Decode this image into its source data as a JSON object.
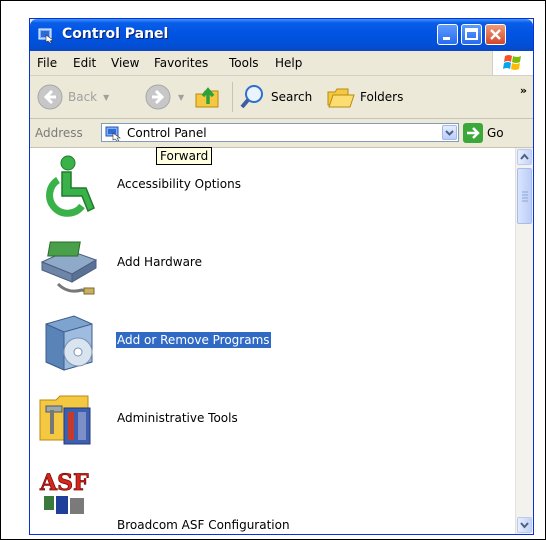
{
  "window": {
    "title": "Control Panel"
  },
  "menu": {
    "file": "File",
    "edit": "Edit",
    "view": "View",
    "favorites": "Favorites",
    "tools": "Tools",
    "help": "Help"
  },
  "toolbar": {
    "back": "Back",
    "search": "Search",
    "folders": "Folders",
    "more": "»"
  },
  "address": {
    "label": "Address",
    "value": "Control Panel",
    "go": "Go"
  },
  "tooltip": "Forward",
  "items": [
    {
      "label": "Accessibility Options",
      "selected": false
    },
    {
      "label": "Add Hardware",
      "selected": false
    },
    {
      "label": "Add or Remove Programs",
      "selected": true
    },
    {
      "label": "Administrative Tools",
      "selected": false
    },
    {
      "label": "Broadcom ASF Configuration",
      "selected": false
    }
  ],
  "icon_text": {
    "asf": "ASF"
  },
  "colors": {
    "title_bar": "#0054e3",
    "selection": "#316ac5",
    "tooltip_bg": "#ffffe1"
  }
}
